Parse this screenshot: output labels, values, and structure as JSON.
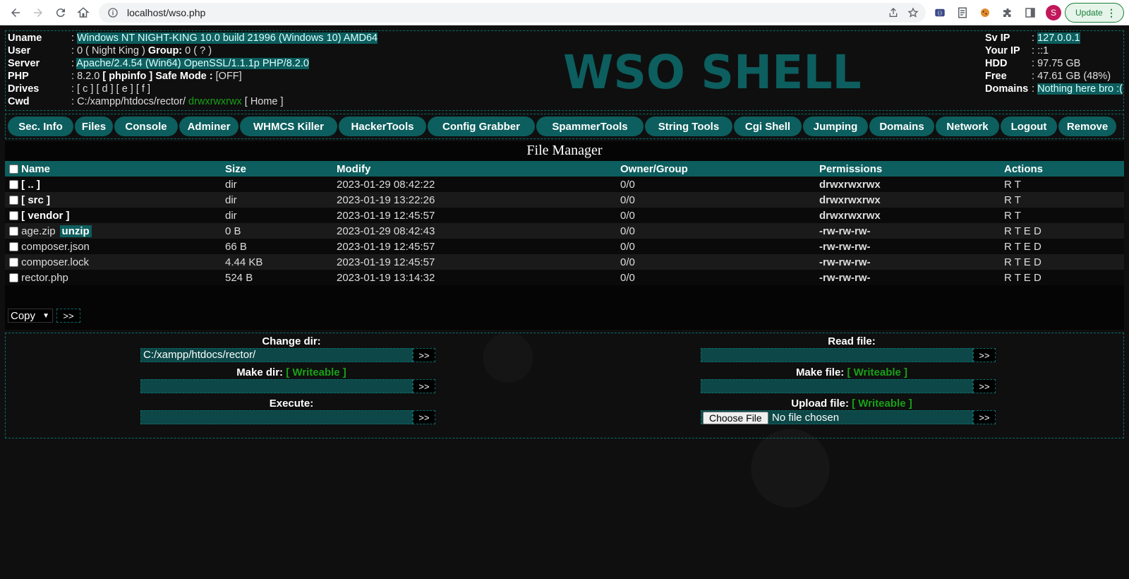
{
  "browser": {
    "url": "localhost/wso.php",
    "avatar_letter": "S",
    "update_label": "Update"
  },
  "info": {
    "rows": [
      {
        "label": "Uname",
        "value": "Windows NT NIGHT-KING 10.0 build 21996 (Windows 10) AMD64"
      },
      {
        "label": "User",
        "value_a": "0 ( Night King ) ",
        "group_label": "Group:",
        "value_b": " 0 ( ? )"
      },
      {
        "label": "Server",
        "value": "Apache/2.4.54 (Win64) OpenSSL/1.1.1p PHP/8.2.0"
      },
      {
        "label": "PHP",
        "value_a": "8.2.0 ",
        "phpinfo": "[ phpinfo ]",
        "safe_label": " Safe Mode :",
        "safe_value": " [OFF]"
      },
      {
        "label": "Drives",
        "value": "[ c ] [ d ] [ e ] [ f ]"
      },
      {
        "label": "Cwd",
        "path": "C:/xampp/htdocs/rector/ ",
        "perm": "drwxrwxrwx",
        "home": " [ Home ]"
      }
    ],
    "separator": ": "
  },
  "logo": "WSO SHELL",
  "server": {
    "rows": [
      {
        "label": "Sv IP",
        "value": "127.0.0.1"
      },
      {
        "label": "Your IP",
        "value": "::1"
      },
      {
        "label": "HDD",
        "value": "97.75 GB"
      },
      {
        "label": "Free",
        "value": "47.61 GB (48%)"
      },
      {
        "label": "Domains",
        "value": "Nothing here bro :("
      }
    ]
  },
  "menu": [
    "Sec. Info",
    "Files",
    "Console",
    "Adminer",
    "WHMCS Killer",
    "HackerTools",
    "Config Grabber",
    "SpammerTools",
    "String Tools",
    "Cgi Shell",
    "Jumping",
    "Domains",
    "Network",
    "Logout",
    "Remove"
  ],
  "file_manager": {
    "title": "File Manager",
    "columns": [
      "Name",
      "Size",
      "Modify",
      "Owner/Group",
      "Permissions",
      "Actions"
    ],
    "rows": [
      {
        "name": "[ .. ]",
        "size": "dir",
        "modify": "2023-01-29 08:42:22",
        "owner": "0/0",
        "perms": "drwxrwxrwx",
        "actions": "R T"
      },
      {
        "name": "[ src ]",
        "size": "dir",
        "modify": "2023-01-19 13:22:26",
        "owner": "0/0",
        "perms": "drwxrwxrwx",
        "actions": "R T"
      },
      {
        "name": "[ vendor ]",
        "size": "dir",
        "modify": "2023-01-19 12:45:57",
        "owner": "0/0",
        "perms": "drwxrwxrwx",
        "actions": "R T"
      },
      {
        "name": "age.zip",
        "extra": "unzip",
        "size": "0 B",
        "modify": "2023-01-29 08:42:43",
        "owner": "0/0",
        "perms": "-rw-rw-rw-",
        "actions": "R T E D"
      },
      {
        "name": "composer.json",
        "size": "66 B",
        "modify": "2023-01-19 12:45:57",
        "owner": "0/0",
        "perms": "-rw-rw-rw-",
        "actions": "R T E D"
      },
      {
        "name": "composer.lock",
        "size": "4.44 KB",
        "modify": "2023-01-19 12:45:57",
        "owner": "0/0",
        "perms": "-rw-rw-rw-",
        "actions": "R T E D"
      },
      {
        "name": "rector.php",
        "size": "524 B",
        "modify": "2023-01-19 13:14:32",
        "owner": "0/0",
        "perms": "-rw-rw-rw-",
        "actions": "R T E D"
      }
    ],
    "bulk_action": "Copy",
    "go_label": ">>"
  },
  "forms": {
    "change_dir": {
      "label": "Change dir:",
      "value": "C:/xampp/htdocs/rector/"
    },
    "make_dir": {
      "label": "Make dir:",
      "writeable": "[ Writeable ]",
      "value": ""
    },
    "execute": {
      "label": "Execute:",
      "value": ""
    },
    "read_file": {
      "label": "Read file:",
      "value": ""
    },
    "make_file": {
      "label": "Make file:",
      "writeable": "[ Writeable ]",
      "value": ""
    },
    "upload_file": {
      "label": "Upload file:",
      "writeable": "[ Writeable ]",
      "choose": "Choose File",
      "no_file": "No file chosen"
    },
    "go_label": ">>"
  },
  "colors": {
    "teal": "#0d5e5e",
    "green": "#18a018",
    "background": "#0f0f0f"
  }
}
